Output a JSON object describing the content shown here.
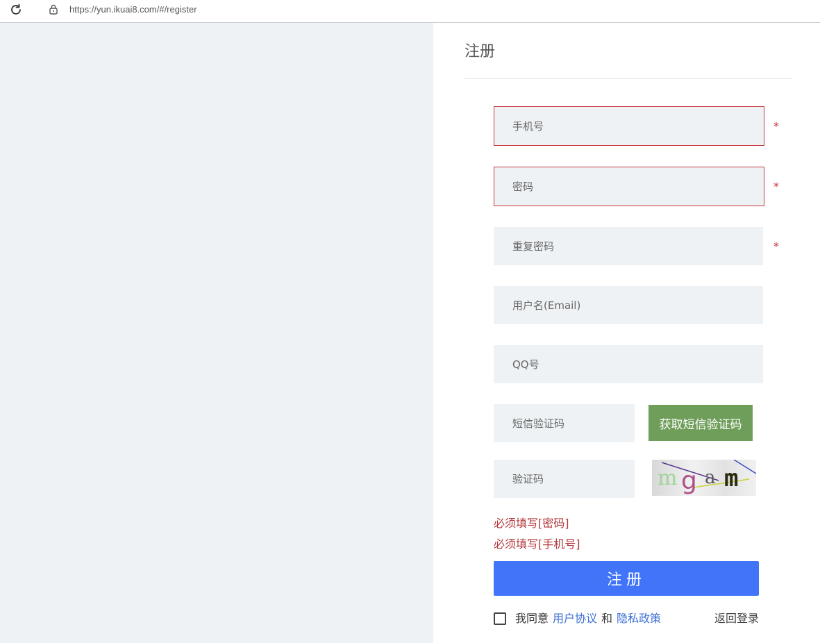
{
  "browser": {
    "url": "https://yun.ikuai8.com/#/register"
  },
  "form": {
    "title": "注册",
    "phone_placeholder": "手机号",
    "password_placeholder": "密码",
    "repeat_password_placeholder": "重复密码",
    "username_placeholder": "用户名(Email)",
    "qq_placeholder": "QQ号",
    "sms_code_placeholder": "短信验证码",
    "sms_button_label": "获取短信验证码",
    "captcha_placeholder": "验证码",
    "captcha_text": "mgam",
    "required_mark": "*",
    "errors": [
      "必须填写[密码]",
      "必须填写[手机号]"
    ],
    "submit_label": "注册",
    "agree_prefix": "我同意",
    "user_agreement_link": "用户协议",
    "and_text": "和",
    "privacy_policy_link": "隐私政策",
    "back_to_login": "返回登录"
  },
  "colors": {
    "error": "#c8363d",
    "primary": "#4174f8",
    "sms_button": "#6e9e5a",
    "link": "#3d6fd6",
    "panel_bg": "#eef2f5"
  }
}
